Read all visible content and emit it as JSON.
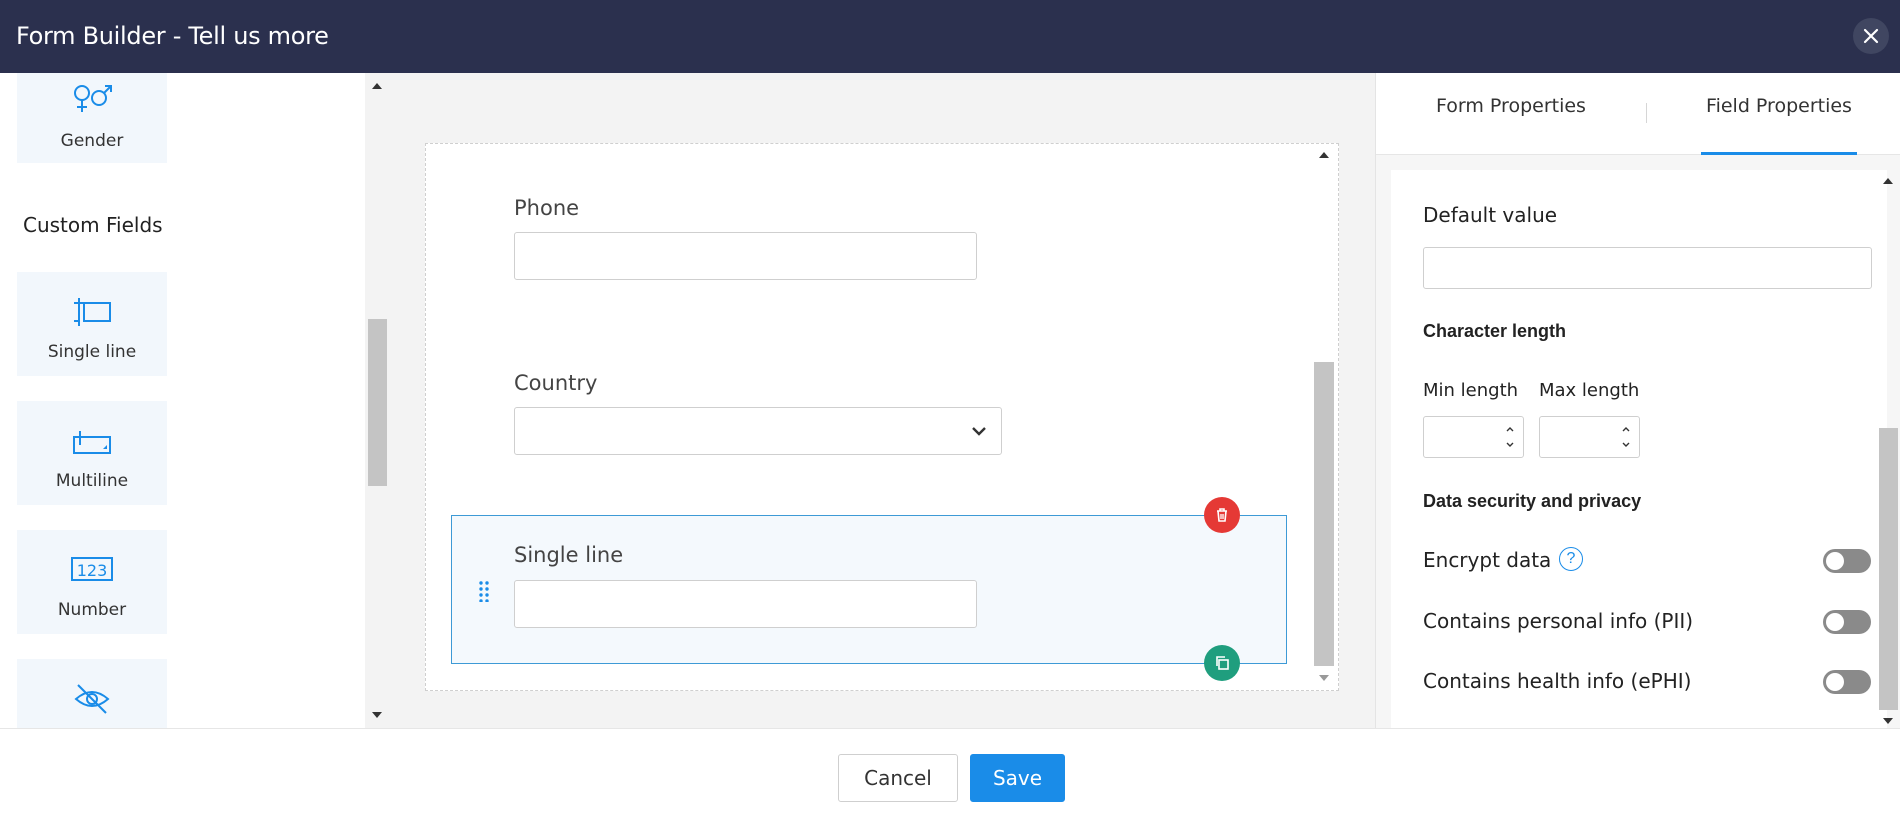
{
  "header": {
    "title": "Form Builder - Tell us more"
  },
  "palette": {
    "items_top": [
      {
        "label": "Gender",
        "icon": "gender-icon"
      }
    ],
    "section_label": "Custom Fields",
    "items": [
      {
        "label": "Single line",
        "icon": "single-line-icon"
      },
      {
        "label": "Multiline",
        "icon": "multiline-icon"
      },
      {
        "label": "Number",
        "icon": "number-icon"
      },
      {
        "label": "",
        "icon": "eye-off-icon"
      }
    ]
  },
  "canvas": {
    "fields": [
      {
        "label": "Phone",
        "type": "text",
        "value": ""
      },
      {
        "label": "Country",
        "type": "select",
        "value": ""
      },
      {
        "label": "Single line",
        "type": "text",
        "value": "",
        "selected": true
      }
    ]
  },
  "right_panel": {
    "tabs": [
      {
        "label": "Form Properties",
        "active": false
      },
      {
        "label": "Field Properties",
        "active": true
      }
    ],
    "default_value": {
      "label": "Default value",
      "value": ""
    },
    "character_length": {
      "heading": "Character length",
      "min_label": "Min length",
      "min_value": "",
      "max_label": "Max length",
      "max_value": ""
    },
    "security": {
      "heading": "Data security and privacy",
      "toggles": [
        {
          "label": "Encrypt data",
          "on": false,
          "help": "?"
        },
        {
          "label": "Contains personal info (PII)",
          "on": false
        },
        {
          "label": "Contains health info (ePHI)",
          "on": false
        }
      ]
    }
  },
  "footer": {
    "cancel_label": "Cancel",
    "save_label": "Save"
  },
  "colors": {
    "header_bg": "#2b304e",
    "accent": "#1a8ce8",
    "delete": "#e53935",
    "duplicate": "#1f9e7e"
  }
}
